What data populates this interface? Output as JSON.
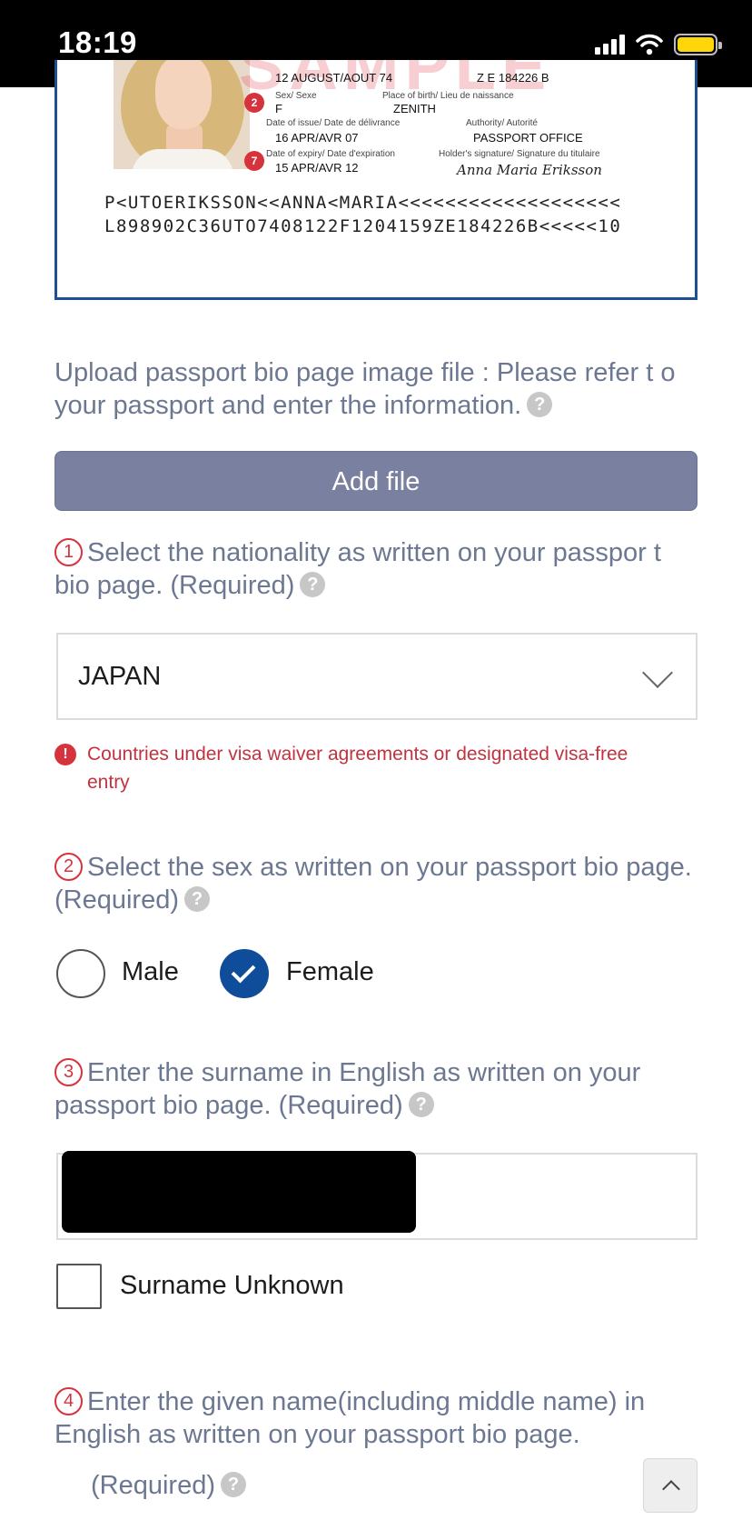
{
  "status_bar": {
    "time": "18:19"
  },
  "passport_sample": {
    "watermark": "SAMPLE",
    "birth_date_value": "12 AUGUST/AOUT 74",
    "personal_no_value": "Z E 184226 B",
    "sex_label": "Sex/ Sexe",
    "sex_value": "F",
    "place_of_birth_label": "Place of birth/ Lieu de naissance",
    "place_of_birth_value": "ZENITH",
    "date_of_issue_label": "Date of issue/ Date de délivrance",
    "date_of_issue_value": "16 APR/AVR 07",
    "authority_label": "Authority/ Autorité",
    "authority_value": "PASSPORT OFFICE",
    "date_of_expiry_label": "Date of expiry/ Date d'expiration",
    "date_of_expiry_value": "15 APR/AVR 12",
    "signature_label": "Holder's signature/ Signature du titulaire",
    "signature_value": "Anna Maria Eriksson",
    "marker_sex": "2",
    "marker_expiry": "7",
    "mrz_line1": "P<UTOERIKSSON<<ANNA<MARIA<<<<<<<<<<<<<<<<<<<",
    "mrz_line2": "L898902C36UTO7408122F1204159ZE184226B<<<<<10"
  },
  "upload": {
    "instruction": "Upload passport bio page image file : Please refer t o your passport and enter the information.",
    "button_label": "Add file"
  },
  "help_icon_glyph": "?",
  "nationality": {
    "number": "1",
    "label": "Select the nationality as written on your passpor t bio page. (Required)",
    "selected": "JAPAN",
    "error_glyph": "!",
    "notice": "Countries under visa waiver agreements or designated visa-free entry"
  },
  "sex": {
    "number": "2",
    "label": "Select the sex as written on your passport bio page. (Required)",
    "options": [
      {
        "label": "Male",
        "selected": false
      },
      {
        "label": "Female",
        "selected": true
      }
    ]
  },
  "surname": {
    "number": "3",
    "label": "Enter the surname in English as written on your passport bio page. (Required)",
    "unknown_label": "Surname Unknown"
  },
  "given_name": {
    "number": "4",
    "label_line1": "Enter the given name(including middle name) in English as written on your passport bio page.",
    "label_line2": "(Required)"
  },
  "colors": {
    "accent_blue": "#0f4c9a",
    "button_grey_blue": "#7a809f",
    "required_red": "#d7333d",
    "label_slate": "#6c7891"
  },
  "icons": {
    "signal": "signal-icon",
    "wifi": "wifi-icon",
    "battery": "battery-icon",
    "help": "question-circle-icon",
    "dropdown": "chevron-down-icon",
    "error": "exclamation-circle-icon",
    "checkmark": "checkmark-icon",
    "scroll_top": "chevron-up-icon"
  }
}
